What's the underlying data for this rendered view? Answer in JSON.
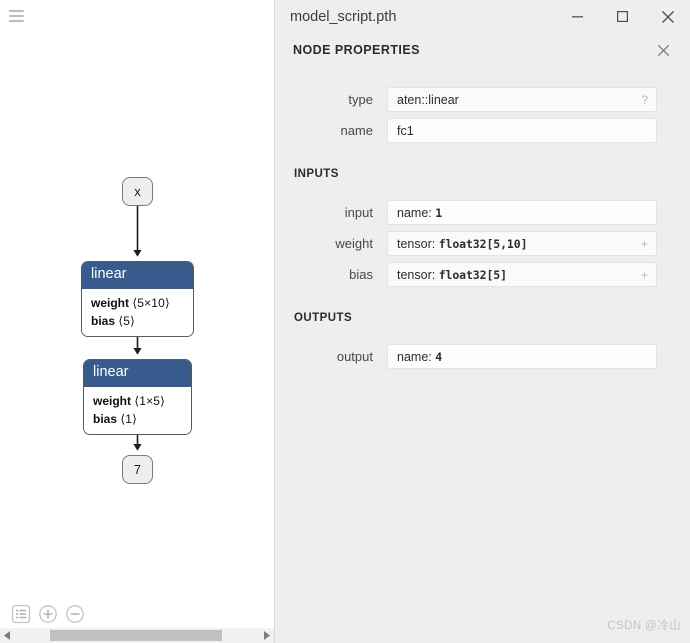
{
  "window": {
    "title": "model_script.pth",
    "minimize_label": "—",
    "maximize_label": "□",
    "close_label": "✕"
  },
  "graph": {
    "menu_icon": "hamburger-icon",
    "nodes": [
      {
        "id": "x",
        "kind": "terminal",
        "label": "x"
      },
      {
        "id": "fc1",
        "kind": "operator",
        "label": "linear",
        "attributes": [
          {
            "name": "weight",
            "value": "⟨5×10⟩"
          },
          {
            "name": "bias",
            "value": "⟨5⟩"
          }
        ]
      },
      {
        "id": "fc2",
        "kind": "operator",
        "label": "linear",
        "attributes": [
          {
            "name": "weight",
            "value": "⟨1×5⟩"
          },
          {
            "name": "bias",
            "value": "⟨1⟩"
          }
        ]
      },
      {
        "id": "7",
        "kind": "terminal",
        "label": "7"
      }
    ],
    "toolbar": [
      {
        "name": "graph-list-button",
        "icon": "list-icon"
      },
      {
        "name": "zoom-in-button",
        "icon": "plus-circle-icon"
      },
      {
        "name": "zoom-out-button",
        "icon": "minus-circle-icon"
      }
    ],
    "scrollbar": {
      "left_arrow": "◀",
      "right_arrow": "▶"
    }
  },
  "sidebar": {
    "title": "NODE PROPERTIES",
    "close_label": "✕",
    "fields": [
      {
        "label": "type",
        "value": "aten::linear",
        "affordance": "?",
        "mono": ""
      },
      {
        "label": "name",
        "value": "fc1",
        "affordance": "",
        "mono": ""
      }
    ],
    "inputs_section": {
      "title": "INPUTS",
      "fields": [
        {
          "label": "input",
          "value": "name: ",
          "mono": "1",
          "affordance": ""
        },
        {
          "label": "weight",
          "value": "tensor: ",
          "mono": "float32[5,10]",
          "affordance": "+"
        },
        {
          "label": "bias",
          "value": "tensor: ",
          "mono": "float32[5]",
          "affordance": "+"
        }
      ]
    },
    "outputs_section": {
      "title": "OUTPUTS",
      "fields": [
        {
          "label": "output",
          "value": "name: ",
          "mono": "4",
          "affordance": ""
        }
      ]
    }
  },
  "watermark": "CSDN @冷山",
  "colors": {
    "node_header_blue": "#365b8c",
    "panel_bg": "#eeeeee",
    "field_bg": "#fafafa",
    "edge": "#222222"
  }
}
